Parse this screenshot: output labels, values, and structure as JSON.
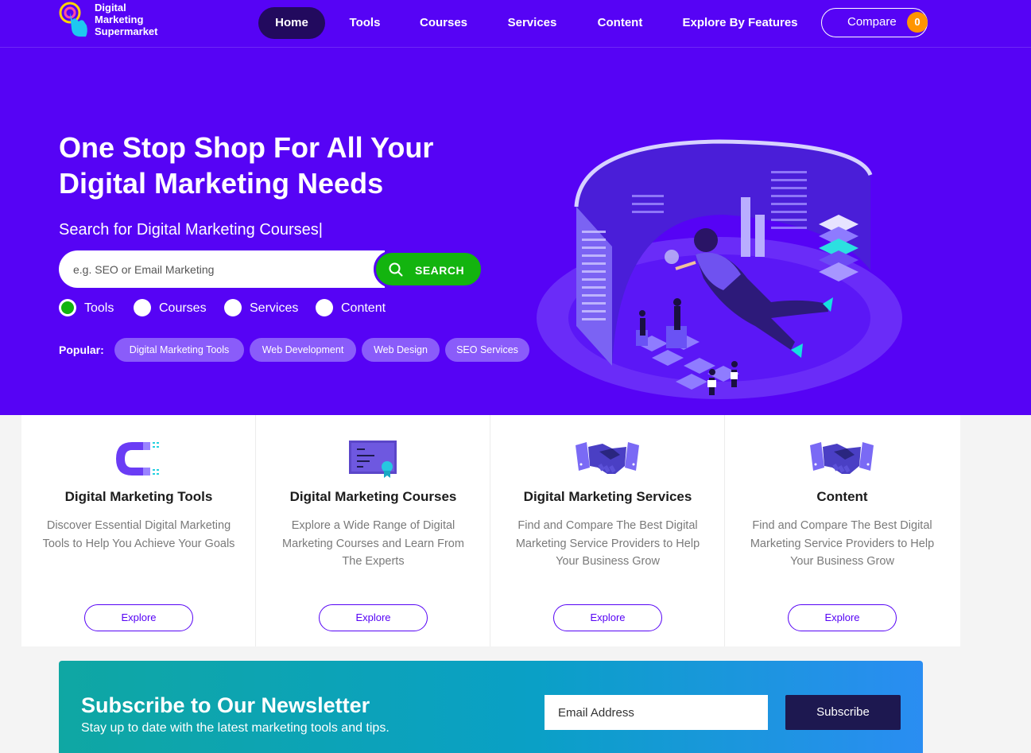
{
  "brand": {
    "name_line1": "Digital",
    "name_line2": "Marketing",
    "name_line3": "Supermarket"
  },
  "nav": {
    "items": [
      {
        "label": "Home",
        "active": true
      },
      {
        "label": "Tools"
      },
      {
        "label": "Courses"
      },
      {
        "label": "Services"
      },
      {
        "label": "Content"
      },
      {
        "label": "Explore By Features"
      }
    ],
    "compare_label": "Compare",
    "compare_count": "0"
  },
  "hero": {
    "title_line1": "One Stop Shop For All Your",
    "title_line2": "Digital Marketing Needs",
    "subtitle": "Search for Digital Marketing Courses|",
    "search_placeholder": "e.g. SEO or Email Marketing",
    "search_button": "SEARCH",
    "search_types": [
      {
        "label": "Tools",
        "selected": true
      },
      {
        "label": "Courses"
      },
      {
        "label": "Services"
      },
      {
        "label": "Content"
      }
    ],
    "popular_label": "Popular:",
    "popular_tags": [
      "Digital Marketing Tools",
      "Web Development",
      "Web Design",
      "SEO Services"
    ]
  },
  "cards": [
    {
      "title": "Digital Marketing Tools",
      "description": "Discover Essential Digital Marketing Tools to Help You Achieve Your Goals",
      "button": "Explore",
      "icon": "magnet-icon"
    },
    {
      "title": "Digital Marketing Courses",
      "description": "Explore a Wide Range of Digital Marketing Courses and Learn From The Experts",
      "button": "Explore",
      "icon": "certificate-icon"
    },
    {
      "title": "Digital Marketing Services",
      "description": "Find and Compare The Best Digital Marketing Service Providers to Help Your Business Grow",
      "button": "Explore",
      "icon": "handshake-icon"
    },
    {
      "title": "Content",
      "description": "Find and Compare The Best Digital Marketing Service Providers to Help Your Business Grow",
      "button": "Explore",
      "icon": "handshake-icon"
    }
  ],
  "newsletter": {
    "title": "Subscribe to Our Newsletter",
    "subtitle": "Stay up to date with the latest marketing tools and tips.",
    "email_placeholder": "Email Address",
    "button": "Subscribe"
  },
  "colors": {
    "primary": "#5603f5",
    "nav_active": "#220a5e",
    "search_green": "#13b40f",
    "badge_orange": "#ff9500",
    "chip": "#8a5cfa",
    "newsletter_button": "#1d1850"
  }
}
